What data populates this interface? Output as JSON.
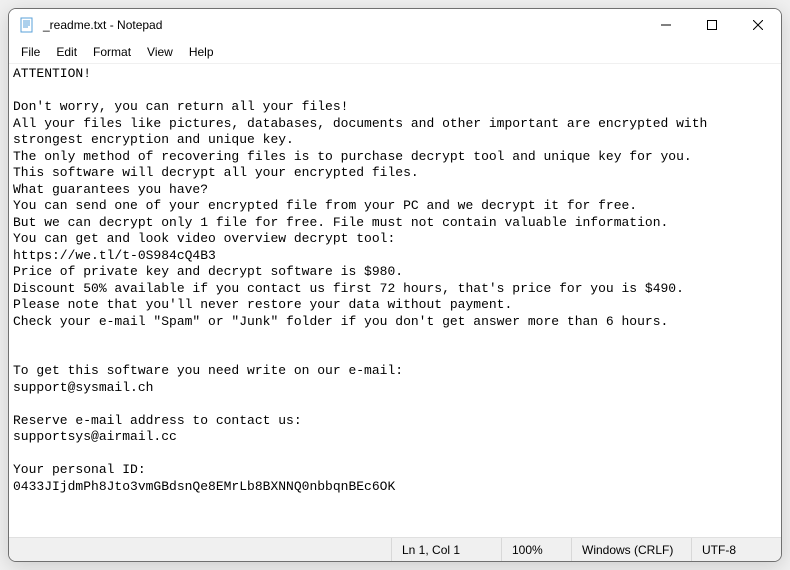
{
  "titlebar": {
    "title": "_readme.txt - Notepad"
  },
  "menu": {
    "file": "File",
    "edit": "Edit",
    "format": "Format",
    "view": "View",
    "help": "Help"
  },
  "content": {
    "text": "ATTENTION!\n\nDon't worry, you can return all your files!\nAll your files like pictures, databases, documents and other important are encrypted with strongest encryption and unique key.\nThe only method of recovering files is to purchase decrypt tool and unique key for you.\nThis software will decrypt all your encrypted files.\nWhat guarantees you have?\nYou can send one of your encrypted file from your PC and we decrypt it for free.\nBut we can decrypt only 1 file for free. File must not contain valuable information.\nYou can get and look video overview decrypt tool:\nhttps://we.tl/t-0S984cQ4B3\nPrice of private key and decrypt software is $980.\nDiscount 50% available if you contact us first 72 hours, that's price for you is $490.\nPlease note that you'll never restore your data without payment.\nCheck your e-mail \"Spam\" or \"Junk\" folder if you don't get answer more than 6 hours.\n\n\nTo get this software you need write on our e-mail:\nsupport@sysmail.ch\n\nReserve e-mail address to contact us:\nsupportsys@airmail.cc\n\nYour personal ID:\n0433JIjdmPh8Jto3vmGBdsnQe8EMrLb8BXNNQ0nbbqnBEc6OK"
  },
  "statusbar": {
    "position": "Ln 1, Col 1",
    "zoom": "100%",
    "line_ending": "Windows (CRLF)",
    "encoding": "UTF-8"
  }
}
